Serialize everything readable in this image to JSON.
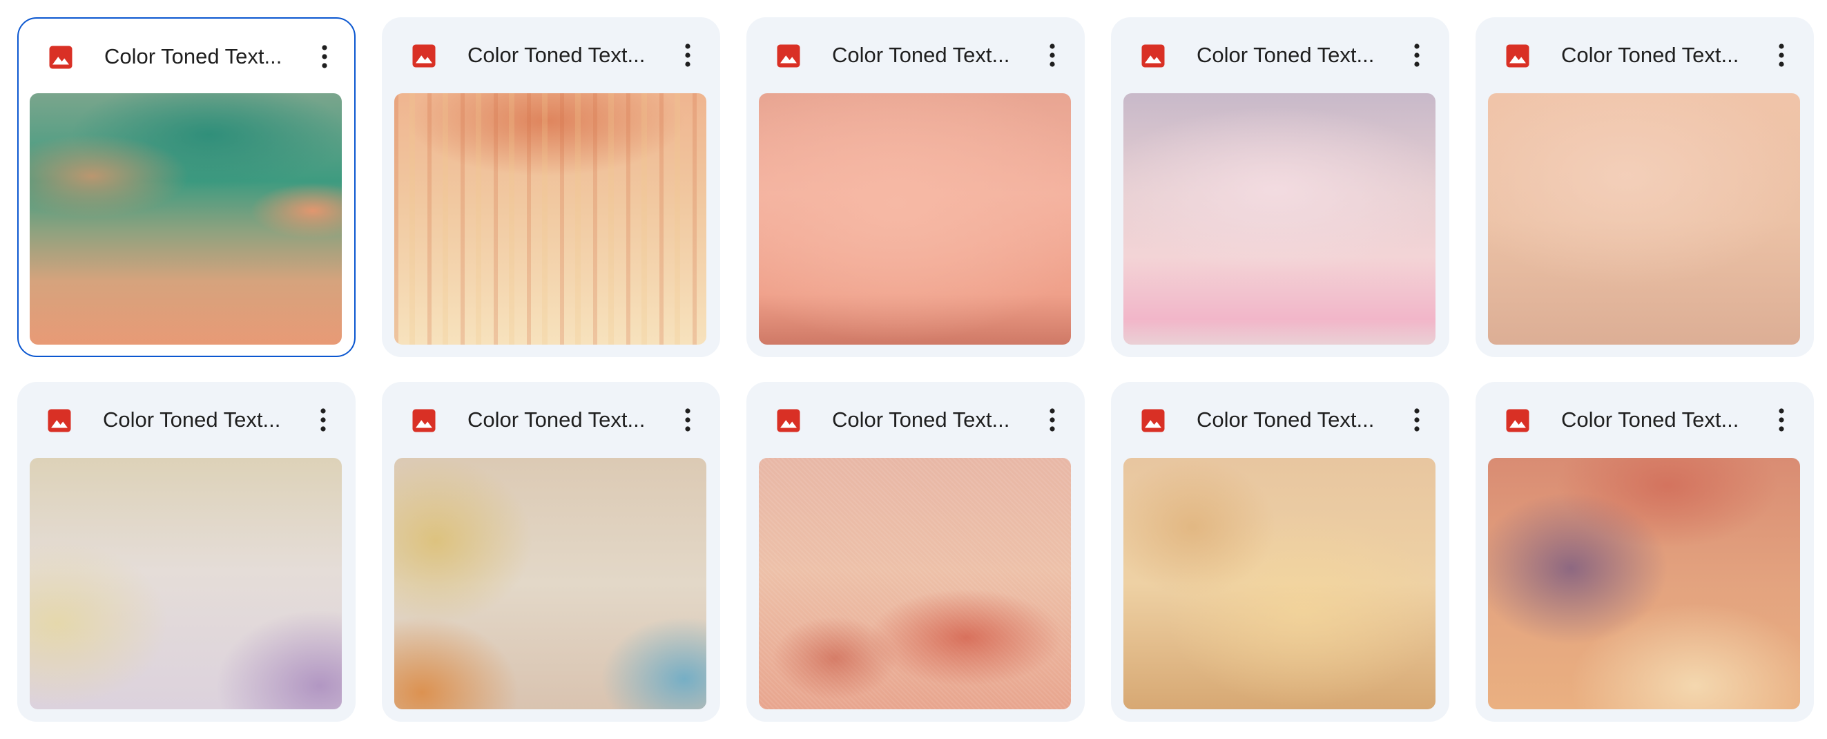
{
  "colors": {
    "card_background": "#f0f4f9",
    "selected_border": "#0b57d0",
    "image_icon": "#d93025",
    "title_text": "#1f1f1f"
  },
  "icons": {
    "file_type": "image-file-icon",
    "more": "more-vertical-icon"
  },
  "files": [
    {
      "title": "Color Toned Text...",
      "selected": true
    },
    {
      "title": "Color Toned Text...",
      "selected": false
    },
    {
      "title": "Color Toned Text...",
      "selected": false
    },
    {
      "title": "Color Toned Text...",
      "selected": false
    },
    {
      "title": "Color Toned Text...",
      "selected": false
    },
    {
      "title": "Color Toned Text...",
      "selected": false
    },
    {
      "title": "Color Toned Text...",
      "selected": false
    },
    {
      "title": "Color Toned Text...",
      "selected": false
    },
    {
      "title": "Color Toned Text...",
      "selected": false
    },
    {
      "title": "Color Toned Text...",
      "selected": false
    }
  ]
}
